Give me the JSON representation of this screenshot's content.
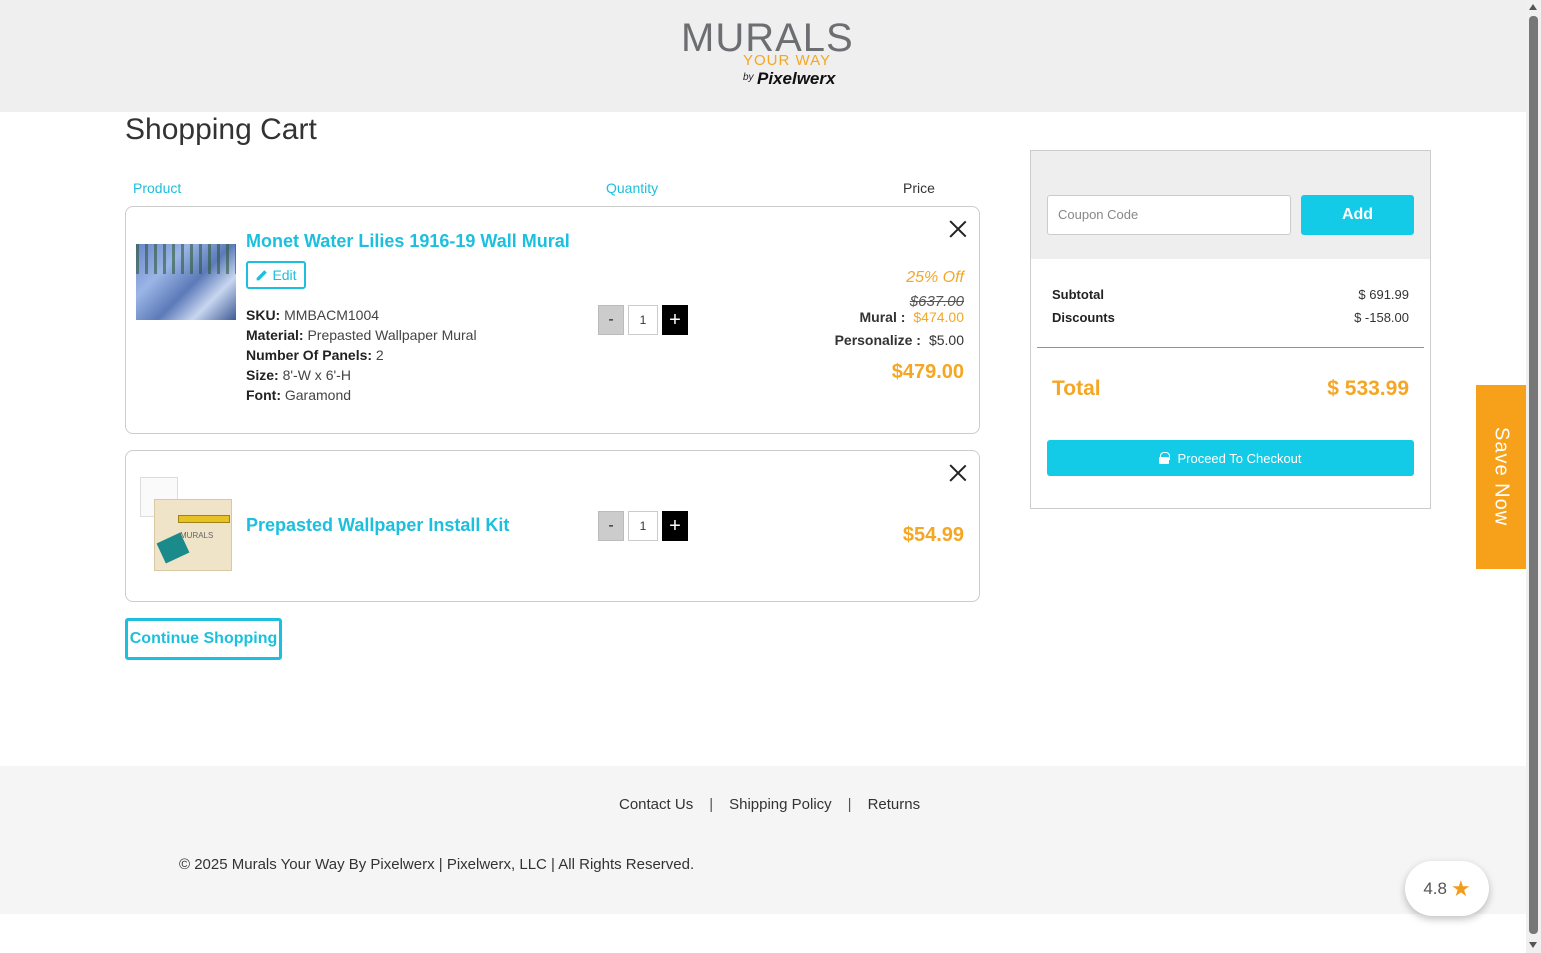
{
  "logo": {
    "main": "MURALS",
    "sub": "YOUR WAY",
    "by": "by",
    "brand": "Pixelwerx"
  },
  "page_title": "Shopping Cart",
  "columns": {
    "product": "Product",
    "quantity": "Quantity",
    "price": "Price"
  },
  "items": [
    {
      "name": "Monet Water Lilies 1916-19 Wall Mural",
      "edit_label": "Edit",
      "specs": [
        {
          "label": "SKU:",
          "value": "MMBACM1004"
        },
        {
          "label": "Material:",
          "value": "Prepasted Wallpaper Mural"
        },
        {
          "label": "Number Of Panels:",
          "value": "2"
        },
        {
          "label": "Size:",
          "value": "8'-W x 6'-H"
        },
        {
          "label": "Font:",
          "value": "Garamond"
        }
      ],
      "quantity": "1",
      "discount": "25% Off",
      "original_price": "$637.00",
      "mural_label": "Mural :",
      "mural_price": "$474.00",
      "personalize_label": "Personalize :",
      "personalize_price": "$5.00",
      "total_price": "$479.00"
    },
    {
      "name": "Prepasted Wallpaper Install Kit",
      "quantity": "1",
      "total_price": "$54.99",
      "kit_label": "MURALS"
    }
  ],
  "qty_minus": "-",
  "qty_plus": "+",
  "continue_label": "Continue Shopping",
  "summary": {
    "coupon_placeholder": "Coupon Code",
    "add_label": "Add",
    "subtotal_label": "Subtotal",
    "subtotal_value": "$ 691.99",
    "discounts_label": "Discounts",
    "discounts_value": "$ -158.00",
    "total_label": "Total",
    "total_value": "$ 533.99",
    "checkout_label": "Proceed To Checkout"
  },
  "save_now": "Save Now",
  "footer": {
    "links": [
      "Contact Us",
      "Shipping Policy",
      "Returns"
    ],
    "separator": "|",
    "copyright": "© 2025 Murals Your Way By Pixelwerx | Pixelwerx, LLC | All Rights Reserved."
  },
  "rating": {
    "value": "4.8",
    "star": "★"
  },
  "colors": {
    "accent": "#1cc0de",
    "price": "#f5a623",
    "save_now": "#f7a01a"
  }
}
